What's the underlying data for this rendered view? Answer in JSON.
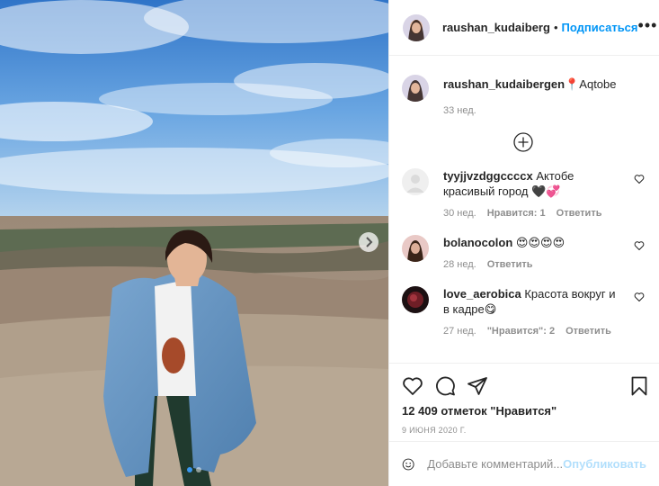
{
  "post": {
    "username": "raushan_kudaiberg",
    "follow_label": "Подписаться",
    "separator": "•",
    "more_icon": "more-horizontal-icon",
    "carousel_dots": 2,
    "active_dot": 0
  },
  "caption": {
    "username": "raushan_kudaibergen",
    "text": "📍Aqtobe",
    "time": "33 нед."
  },
  "comments": [
    {
      "username": "tyyjjvzdggccccx",
      "text": "Актобе красивый город 🖤💞",
      "time": "30 нед.",
      "likes": "Нравится: 1",
      "reply": "Ответить"
    },
    {
      "username": "bolanocolon",
      "text": "😍😍😍😍",
      "time": "28 нед.",
      "reply": "Ответить"
    },
    {
      "username": "love_aerobica",
      "text": "Красота вокруг и в кадре😋",
      "time": "27 нед.",
      "likes": "\"Нравится\": 2",
      "reply": "Ответить"
    }
  ],
  "likes_text": "12 409 отметок \"Нравится\"",
  "date": "9 ИЮНЯ 2020 Г.",
  "add_comment": {
    "placeholder": "Добавьте комментарий...",
    "publish": "Опубликовать"
  },
  "colors": {
    "link": "#0095f6",
    "publish_disabled": "#b2dffc",
    "muted": "#8e8e8e",
    "dot_active": "#3897f0"
  }
}
